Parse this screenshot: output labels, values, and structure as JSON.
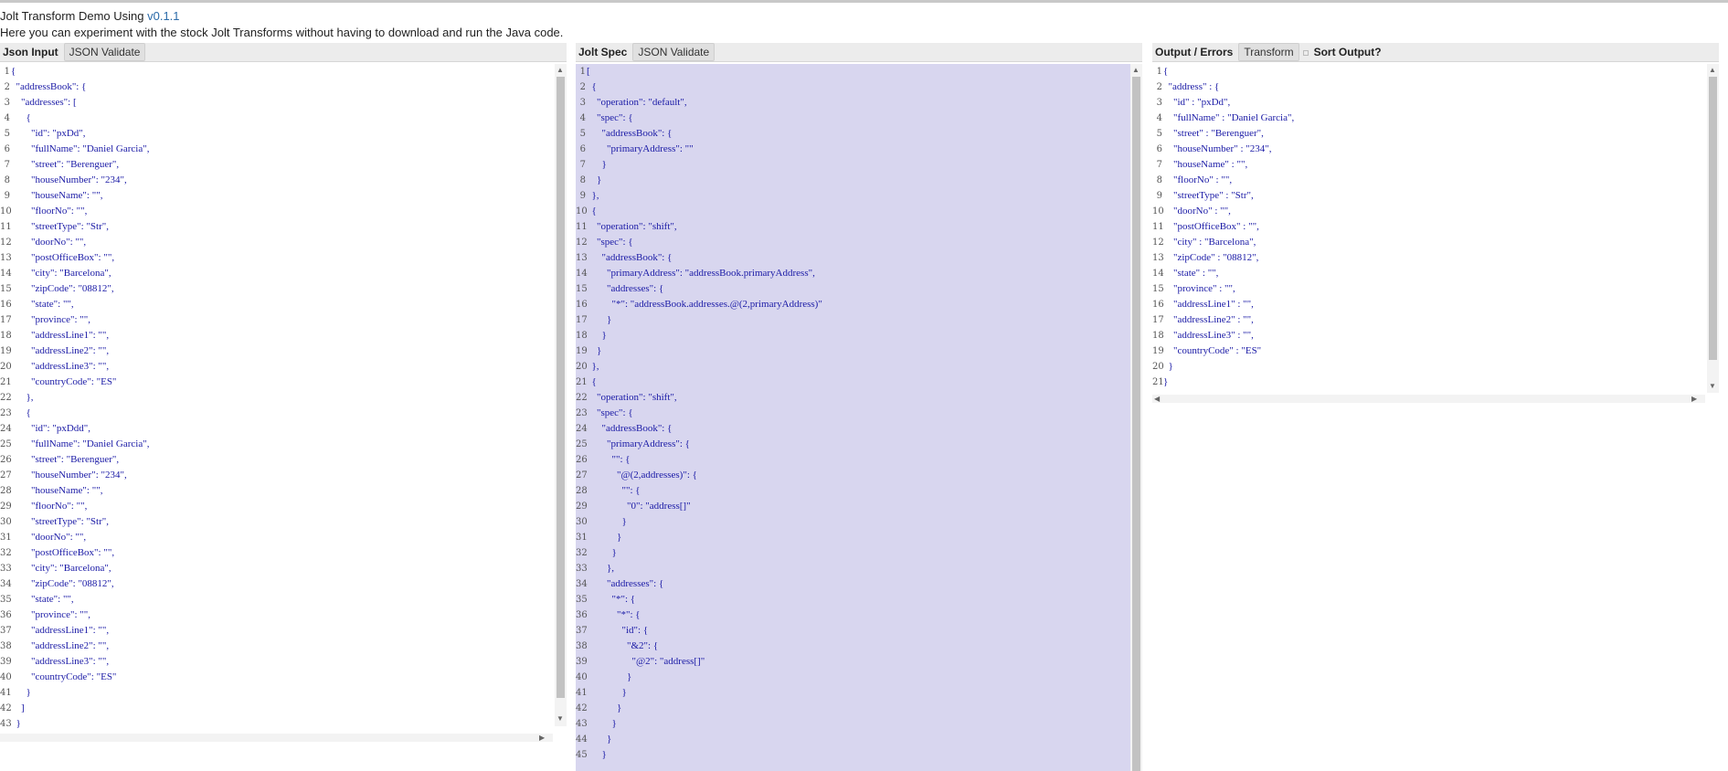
{
  "header": {
    "title": "Jolt Transform Demo Using ",
    "version": "v0.1.1",
    "description": "Here you can experiment with the stock Jolt Transforms without having to download and run the Java code."
  },
  "input_panel": {
    "title": "Json Input",
    "validate_label": "JSON Validate",
    "lines": [
      "{",
      "  \"addressBook\": {",
      "    \"addresses\": [",
      "      {",
      "        \"id\": \"pxDd\",",
      "        \"fullName\": \"Daniel Garcia\",",
      "        \"street\": \"Berenguer\",",
      "        \"houseNumber\": \"234\",",
      "        \"houseName\": \"\",",
      "        \"floorNo\": \"\",",
      "        \"streetType\": \"Str\",",
      "        \"doorNo\": \"\",",
      "        \"postOfficeBox\": \"\",",
      "        \"city\": \"Barcelona\",",
      "        \"zipCode\": \"08812\",",
      "        \"state\": \"\",",
      "        \"province\": \"\",",
      "        \"addressLine1\": \"\",",
      "        \"addressLine2\": \"\",",
      "        \"addressLine3\": \"\",",
      "        \"countryCode\": \"ES\"",
      "      },",
      "      {",
      "        \"id\": \"pxDdd\",",
      "        \"fullName\": \"Daniel Garcia\",",
      "        \"street\": \"Berenguer\",",
      "        \"houseNumber\": \"234\",",
      "        \"houseName\": \"\",",
      "        \"floorNo\": \"\",",
      "        \"streetType\": \"Str\",",
      "        \"doorNo\": \"\",",
      "        \"postOfficeBox\": \"\",",
      "        \"city\": \"Barcelona\",",
      "        \"zipCode\": \"08812\",",
      "        \"state\": \"\",",
      "        \"province\": \"\",",
      "        \"addressLine1\": \"\",",
      "        \"addressLine2\": \"\",",
      "        \"addressLine3\": \"\",",
      "        \"countryCode\": \"ES\"",
      "      }",
      "    ]",
      "  }"
    ]
  },
  "spec_panel": {
    "title": "Jolt Spec",
    "validate_label": "JSON Validate",
    "lines": [
      "[",
      "  {",
      "    \"operation\": \"default\",",
      "    \"spec\": {",
      "      \"addressBook\": {",
      "        \"primaryAddress\": \"\"",
      "      }",
      "    }",
      "  },",
      "  {",
      "    \"operation\": \"shift\",",
      "    \"spec\": {",
      "      \"addressBook\": {",
      "        \"primaryAddress\": \"addressBook.primaryAddress\",",
      "        \"addresses\": {",
      "          \"*\": \"addressBook.addresses.@(2,primaryAddress)\"",
      "        }",
      "      }",
      "    }",
      "  },",
      "  {",
      "    \"operation\": \"shift\",",
      "    \"spec\": {",
      "      \"addressBook\": {",
      "        \"primaryAddress\": {",
      "          \"\": {",
      "            \"@(2,addresses)\": {",
      "              \"\": {",
      "                \"0\": \"address[]\"",
      "              }",
      "            }",
      "          }",
      "        },",
      "        \"addresses\": {",
      "          \"*\": {",
      "            \"*\": {",
      "              \"id\": {",
      "                \"&2\": {",
      "                  \"@2\": \"address[]\"",
      "                }",
      "              }",
      "            }",
      "          }",
      "        }",
      "      }"
    ]
  },
  "output_panel": {
    "title": "Output / Errors",
    "transform_label": "Transform",
    "sort_label": "Sort Output?",
    "lines": [
      "{",
      "  \"address\" : {",
      "    \"id\" : \"pxDd\",",
      "    \"fullName\" : \"Daniel Garcia\",",
      "    \"street\" : \"Berenguer\",",
      "    \"houseNumber\" : \"234\",",
      "    \"houseName\" : \"\",",
      "    \"floorNo\" : \"\",",
      "    \"streetType\" : \"Str\",",
      "    \"doorNo\" : \"\",",
      "    \"postOfficeBox\" : \"\",",
      "    \"city\" : \"Barcelona\",",
      "    \"zipCode\" : \"08812\",",
      "    \"state\" : \"\",",
      "    \"province\" : \"\",",
      "    \"addressLine1\" : \"\",",
      "    \"addressLine2\" : \"\",",
      "    \"addressLine3\" : \"\",",
      "    \"countryCode\" : \"ES\"",
      "  }",
      "}"
    ]
  }
}
